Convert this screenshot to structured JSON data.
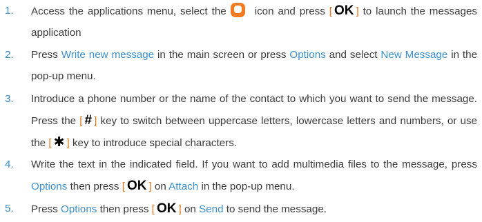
{
  "steps": [
    {
      "num": "1.",
      "parts": [
        {
          "t": "text",
          "v": "Access the applications menu, select the"
        },
        {
          "t": "icon",
          "v": "messages-app-icon"
        },
        {
          "t": "text",
          "v": "icon and press "
        },
        {
          "t": "key",
          "v": "OK"
        },
        {
          "t": "text",
          "v": " to launch the messages application"
        }
      ]
    },
    {
      "num": "2.",
      "parts": [
        {
          "t": "text",
          "v": "Press "
        },
        {
          "t": "hl",
          "v": "Write new message"
        },
        {
          "t": "text",
          "v": " in the main screen or press "
        },
        {
          "t": "hl",
          "v": "Options"
        },
        {
          "t": "text",
          "v": " and select "
        },
        {
          "t": "hl",
          "v": "New Message"
        },
        {
          "t": "text",
          "v": " in the pop-up menu."
        }
      ]
    },
    {
      "num": "3.",
      "parts": [
        {
          "t": "text",
          "v": "Introduce a phone number or the name of the contact to which you want to send the message. Press the "
        },
        {
          "t": "key",
          "v": "#"
        },
        {
          "t": "text",
          "v": " key to switch between uppercase letters, lowercase letters and numbers, or use the "
        },
        {
          "t": "key",
          "v": "✱"
        },
        {
          "t": "text",
          "v": " key to introduce special characters."
        }
      ]
    },
    {
      "num": "4.",
      "parts": [
        {
          "t": "text",
          "v": "Write the text in the indicated field. If you want to add multimedia files to the message, press "
        },
        {
          "t": "hl",
          "v": "Options"
        },
        {
          "t": "text",
          "v": " then press "
        },
        {
          "t": "key",
          "v": "OK"
        },
        {
          "t": "text",
          "v": " on "
        },
        {
          "t": "hl",
          "v": "Attach"
        },
        {
          "t": "text",
          "v": " in the pop-up menu."
        }
      ]
    },
    {
      "num": "5.",
      "parts": [
        {
          "t": "text",
          "v": "Press "
        },
        {
          "t": "hl",
          "v": "Options"
        },
        {
          "t": "text",
          "v": " then press "
        },
        {
          "t": "key",
          "v": "OK"
        },
        {
          "t": "text",
          "v": " on "
        },
        {
          "t": "hl",
          "v": "Send"
        },
        {
          "t": "text",
          "v": " to send the message."
        }
      ]
    }
  ],
  "colors": {
    "number": "#3b8fcf",
    "highlight": "#3b8fcf",
    "bracket": "#e8721c",
    "key": "#000000",
    "icon": "#f47a20",
    "body_text": "#3a3a3a"
  }
}
